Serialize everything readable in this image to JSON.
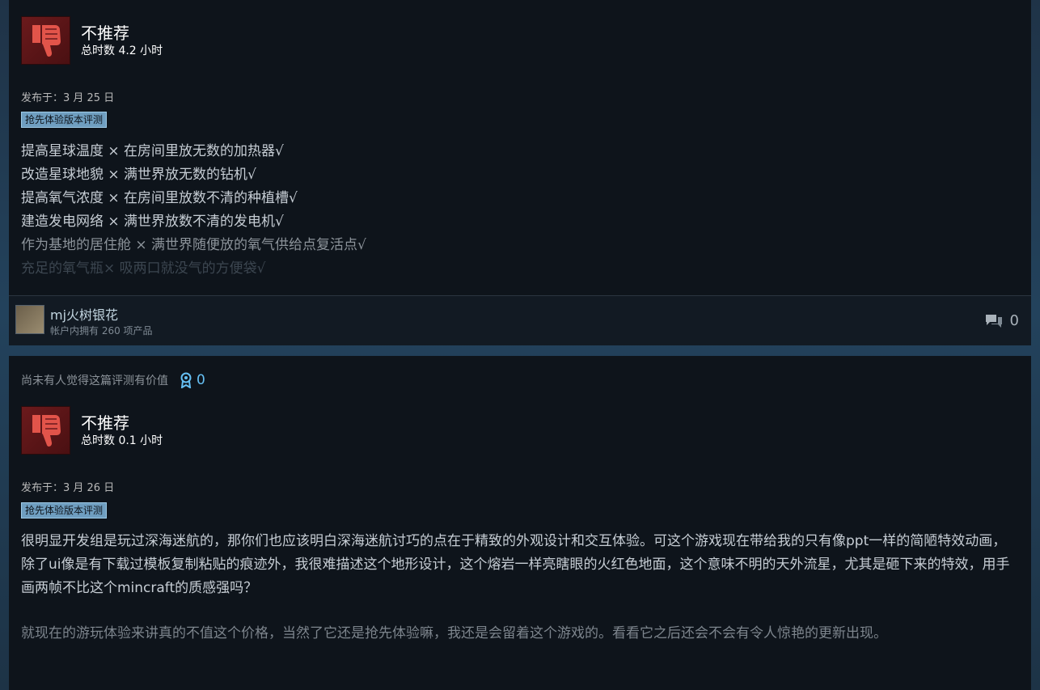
{
  "reviews": [
    {
      "verdict": "不推荐",
      "hours": "总时数 4.2 小时",
      "posted": "发布于：3 月 25 日",
      "badge": "抢先体验版本评测",
      "lines": [
        "提高星球温度 × 在房间里放无数的加热器√",
        "改造星球地貌 × 满世界放无数的钻机√",
        "提高氧气浓度 × 在房间里放数不清的种植槽√",
        "建造发电网络 × 满世界放数不清的发电机√",
        "作为基地的居住舱 × 满世界随便放的氧气供给点复活点√",
        "充足的氧气瓶× 吸两口就没气的方便袋√"
      ],
      "author": "mj火树银花",
      "products": "帐户内拥有 260 项产品",
      "comments": "0"
    },
    {
      "helpful": "尚未有人觉得这篇评测有价值",
      "awards": "0",
      "verdict": "不推荐",
      "hours": "总时数 0.1 小时",
      "posted": "发布于：3 月 26 日",
      "badge": "抢先体验版本评测",
      "para1": "很明显开发组是玩过深海迷航的，那你们也应该明白深海迷航讨巧的点在于精致的外观设计和交互体验。可这个游戏现在带给我的只有像ppt一样的简陋特效动画，除了ui像是有下载过模板复制粘贴的痕迹外，我很难描述这个地形设计，这个熔岩一样亮瞎眼的火红色地面，这个意味不明的天外流星，尤其是砸下来的特效，用手画两帧不比这个mincraft的质感强吗？",
      "para2": "就现在的游玩体验来讲真的不值这个价格，当然了它还是抢先体验嘛，我还是会留着这个游戏的。看看它之后还会不会有令人惊艳的更新出现。"
    }
  ],
  "icons": {
    "verdict": "thumbs-down-icon",
    "comments": "comment-bubble-icon",
    "award": "award-ribbon-icon"
  },
  "colors": {
    "card_bg": "#0e141b",
    "thumb_red": "#e2544a",
    "badge": "#6f9ec0",
    "award": "#66c0f4"
  }
}
